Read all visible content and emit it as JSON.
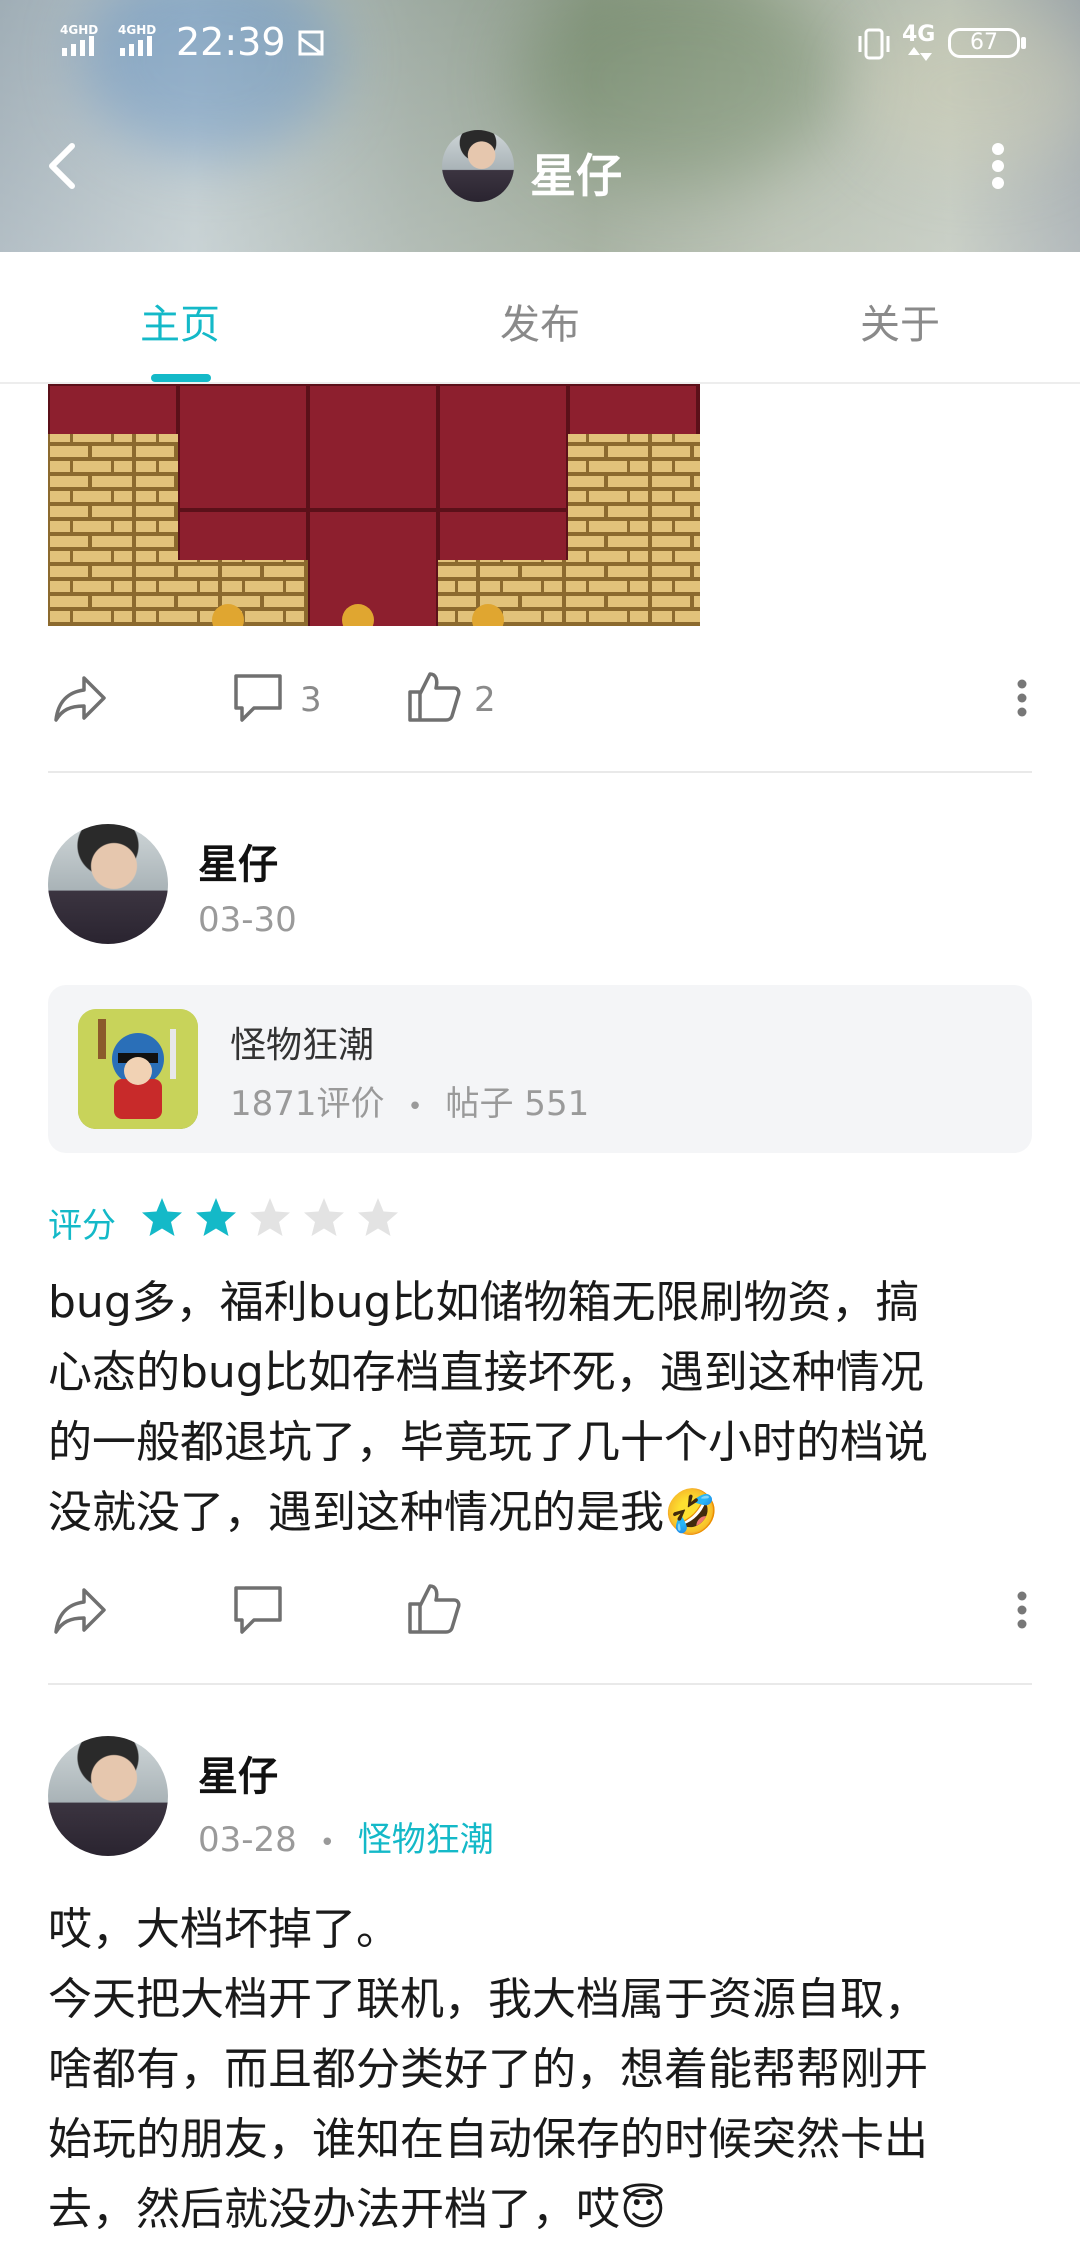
{
  "status_bar": {
    "signal_1": "4GHD",
    "signal_2": "4GHD",
    "time": "22:39",
    "network": "4G",
    "battery": "67"
  },
  "header": {
    "title": "星仔"
  },
  "tabs": [
    {
      "label": "主页",
      "active": true
    },
    {
      "label": "发布",
      "active": false
    },
    {
      "label": "关于",
      "active": false
    }
  ],
  "post1": {
    "comments": "3",
    "likes": "2"
  },
  "post2": {
    "author": "星仔",
    "date": "03-30",
    "game": {
      "name": "怪物狂潮",
      "reviews": "1871评价",
      "separator": "•",
      "posts": "帖子 551"
    },
    "rating_label": "评分",
    "rating": 2,
    "rating_max": 5,
    "text_lines": [
      "bug多，福利bug比如储物箱无限刷物资，搞",
      "心态的bug比如存档直接坏死，遇到这种情况",
      "的一般都退坑了，毕竟玩了几十个小时的档说",
      "没就没了，遇到这种情况的是我🤣"
    ]
  },
  "post3": {
    "author": "星仔",
    "date": "03-28",
    "separator": "•",
    "game": "怪物狂潮",
    "text_lines": [
      "哎，大档坏掉了。",
      "今天把大档开了联机，我大档属于资源自取，",
      "啥都有，而且都分类好了的，想着能帮帮刚开",
      "始玩的朋友，谁知在自动保存的时候突然卡出",
      "去，然后就没办法开档了，哎😇"
    ]
  },
  "colors": {
    "accent": "#14b9c8",
    "star_empty": "#e3e3e3"
  }
}
